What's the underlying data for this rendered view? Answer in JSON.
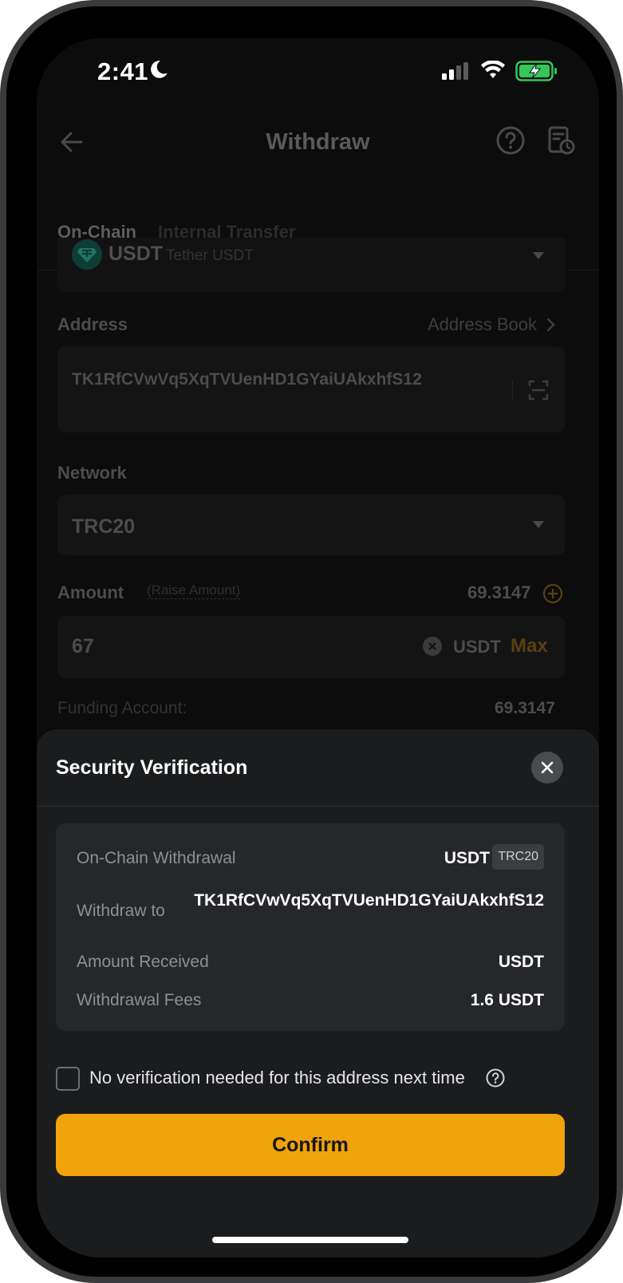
{
  "status_bar": {
    "time": "2:41"
  },
  "header": {
    "title": "Withdraw"
  },
  "tabs": [
    {
      "label": "On-Chain",
      "active": true
    },
    {
      "label": "Internal Transfer",
      "active": false
    }
  ],
  "coin": {
    "symbol": "USDT",
    "name": "Tether USDT"
  },
  "address": {
    "label": "Address",
    "book_link": "Address Book",
    "value": "TK1RfCVwVq5XqTVUenHD1GYaiUAkxhfS12"
  },
  "network": {
    "label": "Network",
    "value": "TRC20"
  },
  "amount": {
    "label": "Amount",
    "raise_link": "(Raise Amount)",
    "available": "69.3147",
    "value": "67",
    "unit": "USDT",
    "max_label": "Max"
  },
  "funding": {
    "label": "Funding Account:",
    "value": "69.3147"
  },
  "sheet": {
    "title": "Security Verification",
    "rows": {
      "type_label": "On-Chain Withdrawal",
      "type_coin": "USDT",
      "type_network": "TRC20",
      "to_label": "Withdraw to",
      "to_value": "TK1RfCVwVq5XqTVUenHD1GYaiUAkxhfS12",
      "received_label": "Amount Received",
      "received_value": "USDT",
      "fees_label": "Withdrawal Fees",
      "fees_value": "1.6 USDT"
    },
    "checkbox_label": "No verification needed for this address next time",
    "confirm_label": "Confirm"
  },
  "colors": {
    "accent": "#f0a30b",
    "sheet_bg": "#1b1c1e",
    "card_bg": "#26272a"
  }
}
